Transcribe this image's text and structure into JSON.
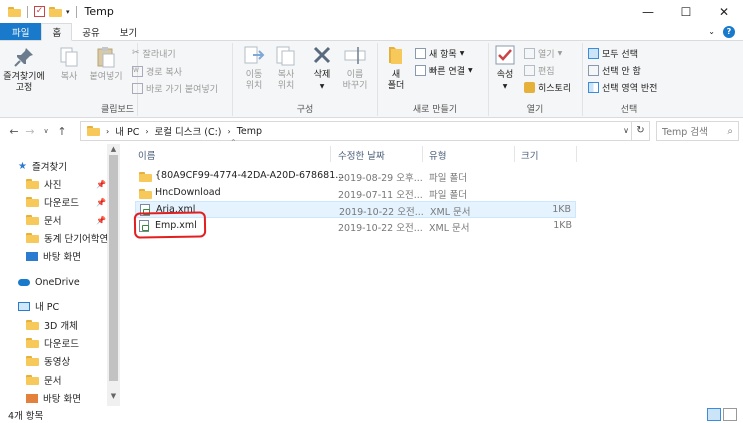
{
  "window": {
    "title": "Temp"
  },
  "tabs": [
    "파일",
    "홈",
    "공유",
    "보기"
  ],
  "ribbon": {
    "clipboard": {
      "pin_label": "즐겨찾기에\n고정",
      "copy_label": "복사",
      "paste_label": "붙여넣기",
      "cut_label": "잘라내기",
      "copy_path_label": "경로 복사",
      "paste_shortcut_label": "바로 가기 붙여넣기",
      "group_label": "클립보드"
    },
    "organize": {
      "move_label": "이동\n위치",
      "copyto_label": "복사\n위치",
      "delete_label": "삭제",
      "rename_label": "이름\n바꾸기",
      "group_label": "구성"
    },
    "new": {
      "newfolder_label": "새\n폴더",
      "newitem_label": "새 항목",
      "easyaccess_label": "빠른 연결",
      "group_label": "새로 만들기"
    },
    "open": {
      "properties_label": "속성",
      "open_label": "열기",
      "edit_label": "편집",
      "history_label": "히스토리",
      "group_label": "열기"
    },
    "select": {
      "selectall_label": "모두 선택",
      "selectnone_label": "선택 안 함",
      "invert_label": "선택 영역 반전",
      "group_label": "선택"
    }
  },
  "address": {
    "crumbs": [
      "내 PC",
      "로컬 디스크 (C:)",
      "Temp"
    ],
    "search_placeholder": "Temp 검색"
  },
  "nav": {
    "quick_access": "즐겨찾기",
    "items": [
      "사진",
      "다운로드",
      "문서",
      "동계 단기어학연",
      "바탕 화면"
    ],
    "onedrive": "OneDrive",
    "thispc": "내 PC",
    "pc_items": [
      "3D 개체",
      "다운로드",
      "동영상",
      "문서",
      "바탕 화면"
    ]
  },
  "columns": [
    "이름",
    "수정한 날짜",
    "유형",
    "크기"
  ],
  "files": [
    {
      "name": "{80A9CF99-4774-42DA-A20D-678681...",
      "date": "2019-08-29 오후...",
      "type": "파일 폴더",
      "size": "",
      "icon": "folder-icon"
    },
    {
      "name": "HncDownload",
      "date": "2019-07-11 오전...",
      "type": "파일 폴더",
      "size": "",
      "icon": "folder-icon"
    },
    {
      "name": "Aria.xml",
      "date": "2019-10-22 오전...",
      "type": "XML 문서",
      "size": "1KB",
      "icon": "xml-file-icon"
    },
    {
      "name": "Emp.xml",
      "date": "2019-10-22 오전...",
      "type": "XML 문서",
      "size": "1KB",
      "icon": "xml-file-icon"
    }
  ],
  "status": {
    "count": "4개 항목"
  },
  "colors": {
    "accent": "#1979ca",
    "folder": "#f7c95b",
    "annotation": "#e21f1f"
  }
}
